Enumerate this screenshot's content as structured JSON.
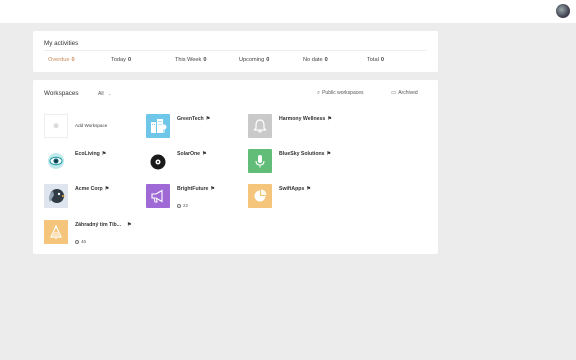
{
  "header": {
    "avatar_icon": "user-avatar"
  },
  "activities": {
    "title": "My activities",
    "items": [
      {
        "label": "Overdue",
        "count": "0"
      },
      {
        "label": "Today",
        "count": "0"
      },
      {
        "label": "This Week",
        "count": "0"
      },
      {
        "label": "Upcoming",
        "count": "0"
      },
      {
        "label": "No date",
        "count": "0"
      },
      {
        "label": "Total",
        "count": "0"
      }
    ],
    "overdue_color": "#c98a5a"
  },
  "workspaces": {
    "title": "Workspaces",
    "filter_value": "All",
    "public_label": "Public workspaces",
    "archived_label": "Archived",
    "add_label": "Add Workspace",
    "items": [
      {
        "name": "GreenTech",
        "icon": "city-icon",
        "color": "#6ec6e8",
        "count": ""
      },
      {
        "name": "Harmony Wellness",
        "icon": "bell-icon",
        "color": "#c9c9c9",
        "count": ""
      },
      {
        "name": "EcoLiving",
        "icon": "eye-icon",
        "color": "#ffffff",
        "count": ""
      },
      {
        "name": "SolarOne",
        "icon": "disc-icon",
        "color": "#ffffff",
        "count": ""
      },
      {
        "name": "BlueSky Solutions",
        "icon": "microphone-icon",
        "color": "#62bd78",
        "count": ""
      },
      {
        "name": "Acme Corp",
        "icon": "bird-icon",
        "color": "#dfe5ee",
        "count": ""
      },
      {
        "name": "BrightFuture",
        "icon": "megaphone-icon",
        "color": "#9f6ad6",
        "count": "22"
      },
      {
        "name": "SwiftApps",
        "icon": "pie-chart-icon",
        "color": "#f4c57a",
        "count": ""
      },
      {
        "name": "Záhradný tím Tib...",
        "icon": "tree-icon",
        "color": "#f4c57a",
        "count": "46"
      }
    ]
  }
}
